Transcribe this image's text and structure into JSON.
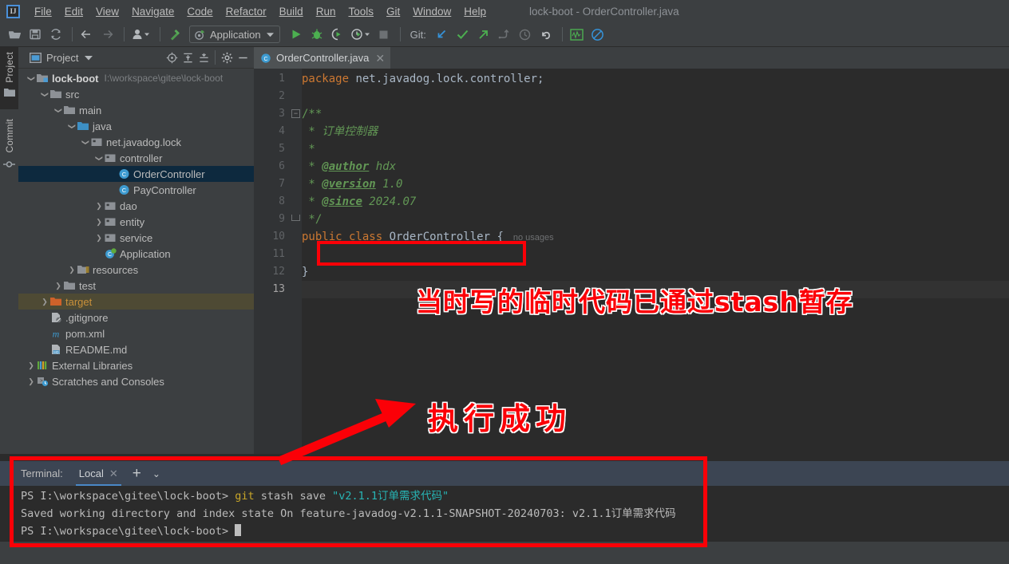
{
  "window": {
    "title": "lock-boot - OrderController.java",
    "logo_text": "IJ"
  },
  "menubar": {
    "items": [
      {
        "label": "File"
      },
      {
        "label": "Edit"
      },
      {
        "label": "View"
      },
      {
        "label": "Navigate"
      },
      {
        "label": "Code"
      },
      {
        "label": "Refactor"
      },
      {
        "label": "Build"
      },
      {
        "label": "Run"
      },
      {
        "label": "Tools"
      },
      {
        "label": "Git"
      },
      {
        "label": "Window"
      },
      {
        "label": "Help"
      }
    ]
  },
  "toolbar": {
    "icons_left": [
      "open-folder-icon",
      "save-icon",
      "sync-icon"
    ],
    "nav_icons": [
      "back-arrow-icon",
      "forward-arrow-icon"
    ],
    "profile_icon": "user-dropdown-icon",
    "build_icon": "hammer-icon",
    "run_config": {
      "label": "Application",
      "icon": "application-run-config-icon"
    },
    "run_icons": [
      "run-icon",
      "debug-icon",
      "run-with-coverage-icon",
      "profiler-icon",
      "stop-icon"
    ],
    "git_label": "Git:",
    "git_icons": [
      "update-project-icon",
      "commit-icon",
      "push-icon",
      "branches-icon",
      "history-icon",
      "rollback-icon"
    ],
    "right_icons": [
      "inspections-widget-icon",
      "no-access-icon"
    ]
  },
  "left_strip": {
    "tabs": [
      {
        "label": "Project",
        "icon": "project-folder-icon",
        "selected": true
      },
      {
        "label": "Commit",
        "icon": "commit-node-icon",
        "selected": false
      }
    ]
  },
  "project_panel": {
    "title": "Project",
    "dropdown_icon": "chevron-down-icon",
    "header_icons": [
      "select-opened-file-icon",
      "expand-all-icon",
      "collapse-all-icon",
      "settings-gear-icon",
      "hide-icon"
    ],
    "tree": [
      {
        "depth": 0,
        "arrow": "v",
        "icon": "module-folder-icon",
        "label": "lock-boot",
        "bold": true,
        "sub": "I:\\workspace\\gitee\\lock-boot",
        "state": "normal"
      },
      {
        "depth": 1,
        "arrow": "v",
        "icon": "folder-icon",
        "label": "src",
        "state": "normal"
      },
      {
        "depth": 2,
        "arrow": "v",
        "icon": "folder-icon",
        "label": "main",
        "state": "normal"
      },
      {
        "depth": 3,
        "arrow": "v",
        "icon": "source-folder-icon",
        "label": "java",
        "state": "normal"
      },
      {
        "depth": 4,
        "arrow": "v",
        "icon": "package-icon",
        "label": "net.javadog.lock",
        "state": "normal"
      },
      {
        "depth": 5,
        "arrow": "v",
        "icon": "package-icon",
        "label": "controller",
        "state": "normal"
      },
      {
        "depth": 6,
        "arrow": "",
        "icon": "java-class-icon",
        "label": "OrderController",
        "state": "selected"
      },
      {
        "depth": 6,
        "arrow": "",
        "icon": "java-class-icon",
        "label": "PayController",
        "state": "normal"
      },
      {
        "depth": 5,
        "arrow": ">",
        "icon": "package-icon",
        "label": "dao",
        "state": "normal"
      },
      {
        "depth": 5,
        "arrow": ">",
        "icon": "package-icon",
        "label": "entity",
        "state": "normal"
      },
      {
        "depth": 5,
        "arrow": ">",
        "icon": "package-icon",
        "label": "service",
        "state": "normal"
      },
      {
        "depth": 5,
        "arrow": "",
        "icon": "spring-class-icon",
        "label": "Application",
        "state": "normal"
      },
      {
        "depth": 3,
        "arrow": ">",
        "icon": "resources-folder-icon",
        "label": "resources",
        "state": "normal"
      },
      {
        "depth": 2,
        "arrow": ">",
        "icon": "folder-icon",
        "label": "test",
        "state": "normal"
      },
      {
        "depth": 1,
        "arrow": ">",
        "icon": "target-folder-icon",
        "label": "target",
        "state": "target"
      },
      {
        "depth": 1,
        "arrow": "",
        "icon": "gitignore-file-icon",
        "label": ".gitignore",
        "state": "normal"
      },
      {
        "depth": 1,
        "arrow": "",
        "icon": "maven-file-icon",
        "label": "pom.xml",
        "state": "normal"
      },
      {
        "depth": 1,
        "arrow": "",
        "icon": "markdown-file-icon",
        "label": "README.md",
        "state": "normal"
      },
      {
        "depth": 0,
        "arrow": ">",
        "icon": "libraries-icon",
        "label": "External Libraries",
        "state": "normal"
      },
      {
        "depth": 0,
        "arrow": ">",
        "icon": "scratches-icon",
        "label": "Scratches and Consoles",
        "state": "normal"
      }
    ]
  },
  "editor": {
    "tab": {
      "filename": "OrderController.java",
      "icon": "java-class-icon",
      "close_icon": "close-icon"
    },
    "current_line": 13,
    "inlay_hint": "no usages",
    "lines": [
      {
        "n": 1,
        "tokens": [
          {
            "t": "package ",
            "c": "kw"
          },
          {
            "t": "net.javadog.lock.controller",
            "c": "pl"
          },
          {
            "t": ";",
            "c": "pl"
          }
        ]
      },
      {
        "n": 2,
        "tokens": []
      },
      {
        "n": 3,
        "tokens": [
          {
            "t": "/**",
            "c": "cm"
          }
        ],
        "fold": "minus"
      },
      {
        "n": 4,
        "tokens": [
          {
            "t": " * ",
            "c": "cm"
          },
          {
            "t": "订单控制器",
            "c": "cmi"
          }
        ]
      },
      {
        "n": 5,
        "tokens": [
          {
            "t": " *",
            "c": "cm"
          }
        ]
      },
      {
        "n": 6,
        "tokens": [
          {
            "t": " * ",
            "c": "cm"
          },
          {
            "t": "@author",
            "c": "tag"
          },
          {
            "t": " hdx",
            "c": "cmi"
          }
        ]
      },
      {
        "n": 7,
        "tokens": [
          {
            "t": " * ",
            "c": "cm"
          },
          {
            "t": "@version",
            "c": "tag"
          },
          {
            "t": " 1.0",
            "c": "cmi"
          }
        ]
      },
      {
        "n": 8,
        "tokens": [
          {
            "t": " * ",
            "c": "cm"
          },
          {
            "t": "@since",
            "c": "tag"
          },
          {
            "t": " 2024.07",
            "c": "cmi"
          }
        ]
      },
      {
        "n": 9,
        "tokens": [
          {
            "t": " */",
            "c": "cm"
          }
        ],
        "fold": "end"
      },
      {
        "n": 10,
        "tokens": [
          {
            "t": "public class ",
            "c": "kw"
          },
          {
            "t": "OrderController ",
            "c": "cls"
          },
          {
            "t": "{",
            "c": "pl"
          }
        ],
        "hint": "no usages"
      },
      {
        "n": 11,
        "tokens": []
      },
      {
        "n": 12,
        "tokens": [
          {
            "t": "}",
            "c": "pl"
          }
        ]
      },
      {
        "n": 13,
        "tokens": []
      }
    ]
  },
  "terminal": {
    "label": "Terminal:",
    "tab": {
      "label": "Local",
      "close_icon": "close-icon"
    },
    "add_icon": "plus-icon",
    "options_icon": "chevron-down-icon",
    "lines": [
      {
        "segments": [
          {
            "t": "PS I:\\workspace\\gitee\\lock-boot> ",
            "c": "plain"
          },
          {
            "t": "git",
            "c": "git"
          },
          {
            "t": " stash save ",
            "c": "plain"
          },
          {
            "t": "\"v2.1.1订单需求代码\"",
            "c": "str"
          }
        ]
      },
      {
        "segments": [
          {
            "t": "Saved working directory and index state On feature-javadog-v2.1.1-SNAPSHOT-20240703: v2.1.1订单需求代码",
            "c": "plain"
          }
        ]
      },
      {
        "segments": [
          {
            "t": "PS I:\\workspace\\gitee\\lock-boot> ",
            "c": "plain"
          },
          {
            "t": "",
            "c": "caret"
          }
        ]
      }
    ]
  },
  "annotations": {
    "note1": "当时写的临时代码已通过stash暂存",
    "note2": "执行成功",
    "arrow": "red-arrow-annotation",
    "box_code": "red-highlight-box-code",
    "box_terminal": "red-highlight-box-terminal"
  },
  "colors": {
    "accent_red": "#fb0007",
    "selection_blue": "#0d293e",
    "target_olive": "#4e4a34",
    "terminal_header": "#3c4553",
    "tab_underline": "#4a88c7"
  }
}
